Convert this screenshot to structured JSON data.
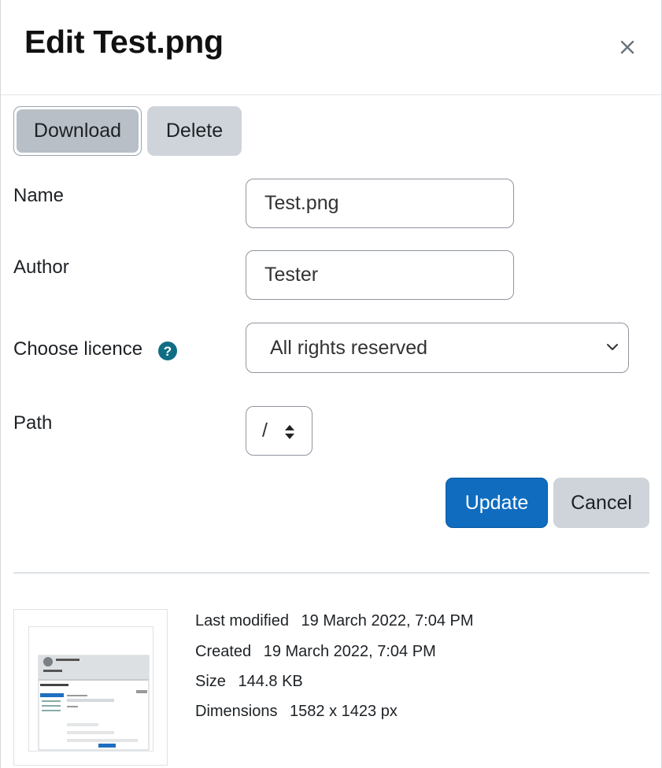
{
  "dialog": {
    "title": "Edit Test.png",
    "close_icon": "close-icon"
  },
  "actions": {
    "download_label": "Download",
    "delete_label": "Delete"
  },
  "form": {
    "name_label": "Name",
    "name_value": "Test.png",
    "author_label": "Author",
    "author_value": "Tester",
    "licence_label": "Choose licence",
    "licence_help_icon": "question-circle-icon",
    "licence_value": "All rights reserved",
    "path_label": "Path",
    "path_value": "/"
  },
  "footer": {
    "update_label": "Update",
    "cancel_label": "Cancel"
  },
  "file_info": {
    "last_modified_label": "Last modified",
    "last_modified_value": "19 March 2022, 7:04 PM",
    "created_label": "Created",
    "created_value": "19 March 2022, 7:04 PM",
    "size_label": "Size",
    "size_value": "144.8 KB",
    "dimensions_label": "Dimensions",
    "dimensions_value": "1582 x 1423 px"
  },
  "colors": {
    "primary": "#0f6cbf",
    "secondary": "#ced4da",
    "help": "#0f6e84"
  }
}
